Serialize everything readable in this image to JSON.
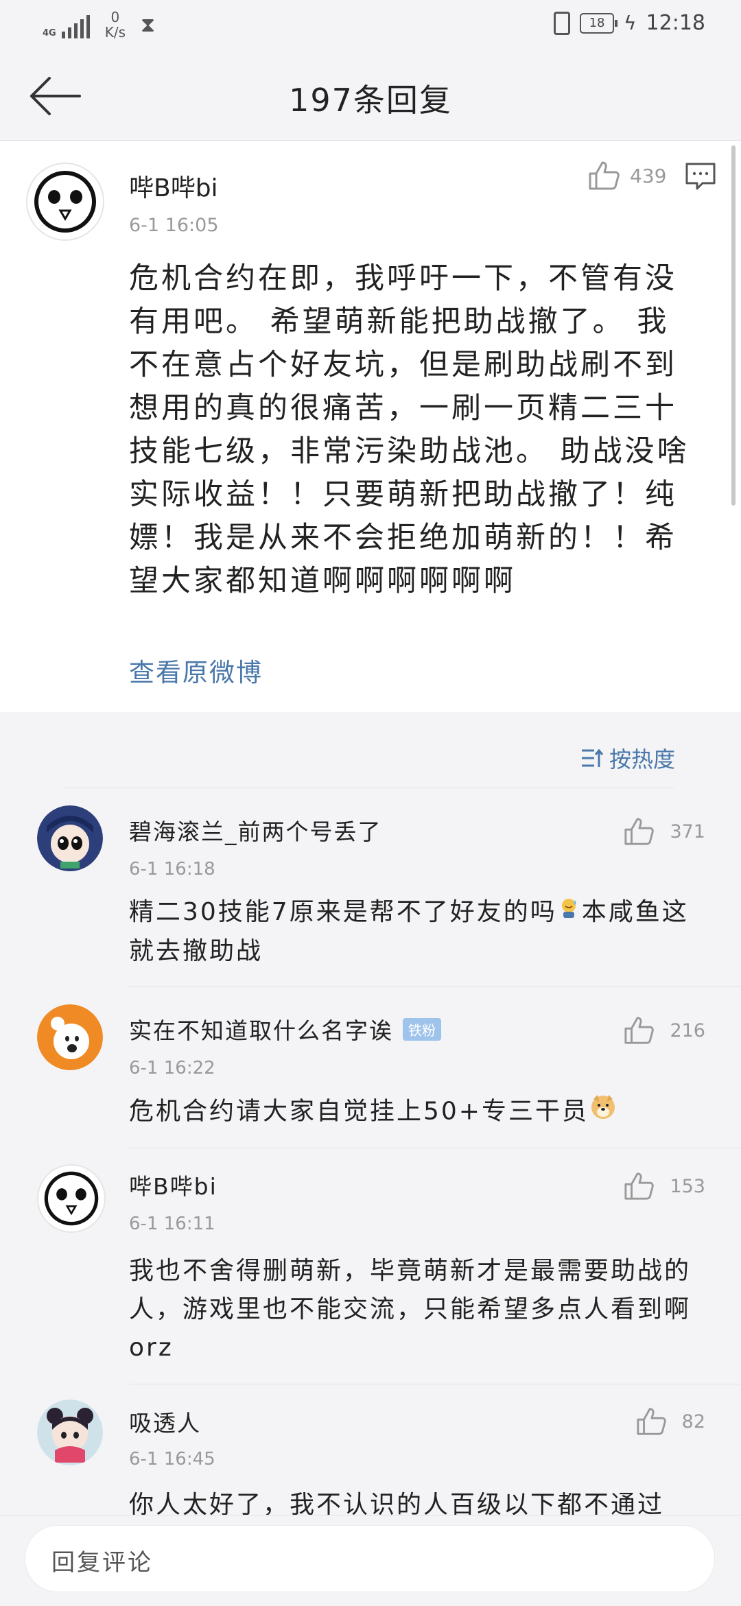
{
  "status_bar": {
    "network": "4G",
    "speed_value": "0",
    "speed_unit": "K/s",
    "battery": "18",
    "time": "12:18"
  },
  "header": {
    "title": "197条回复",
    "back_icon": "arrow-left-icon"
  },
  "post": {
    "username": "哔B哔bi",
    "time": "6-1 16:05",
    "likes": "439",
    "text": "危机合约在即，我呼吁一下，不管有没有用吧。 希望萌新能把助战撤了。 我不在意占个好友坑，但是刷助战刷不到想用的真的很痛苦，一刷一页精二三十技能七级，非常污染助战池。 助战没啥实际收益！！只要萌新把助战撤了！纯嫖！我是从来不会拒绝加萌新的！！希望大家都知道啊啊啊啊啊啊",
    "view_original": "查看原微博"
  },
  "sort": {
    "label": "按热度"
  },
  "comments": [
    {
      "username": "碧海滚兰_前两个号丢了",
      "time": "6-1 16:18",
      "likes": "371",
      "text_before": "精二30技能7原来是帮不了好友的吗",
      "text_after": "本咸鱼这就去撤助战"
    },
    {
      "username": "实在不知道取什么名字诶",
      "badge": "铁粉",
      "time": "6-1 16:22",
      "likes": "216",
      "text": "危机合约请大家自觉挂上50+专三干员"
    },
    {
      "username": "哔B哔bi",
      "time": "6-1 16:11",
      "likes": "153",
      "text": "我也不舍得删萌新，毕竟萌新才是最需要助战的人，游戏里也不能交流，只能希望多点人看到啊orz"
    },
    {
      "username": "吸透人",
      "time": "6-1 16:45",
      "likes": "82",
      "text": "你人太好了，我不认识的人百级以下都不通过"
    }
  ],
  "reply_box": {
    "placeholder": "回复评论"
  }
}
